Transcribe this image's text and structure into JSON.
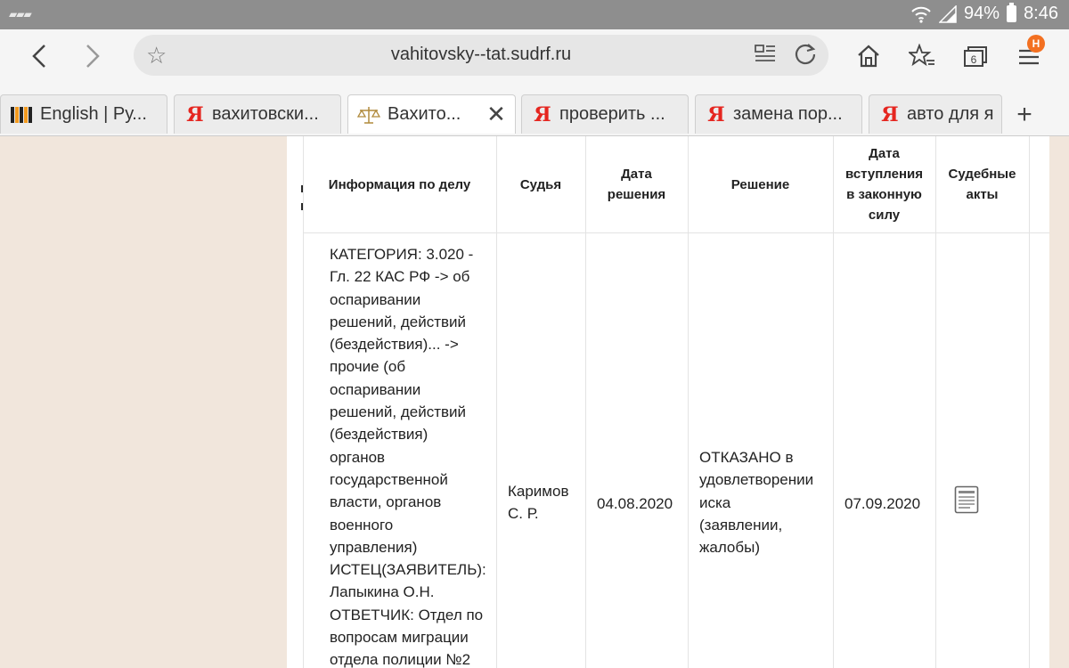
{
  "status": {
    "battery": "94%",
    "time": "8:46"
  },
  "toolbar": {
    "url": "vahitovsky--tat.sudrf.ru",
    "tab_count": "6",
    "badge": "Н"
  },
  "tabs": [
    {
      "label": "English | Ру..."
    },
    {
      "label": "вахитовски..."
    },
    {
      "label": "Вахито..."
    },
    {
      "label": "проверить ..."
    },
    {
      "label": "замена пор..."
    },
    {
      "label": "авто для я"
    }
  ],
  "table": {
    "headers": {
      "info": "Информация по делу",
      "judge": "Судья",
      "date": [
        "Дата",
        "решения"
      ],
      "decision": "Решение",
      "effective": [
        "Дата",
        "вступления",
        "в законную",
        "силу"
      ],
      "acts": [
        "Судебные",
        "акты"
      ]
    },
    "row": {
      "info_lines": [
        "КАТЕГОРИЯ: 3.020 -",
        "Гл. 22 КАС РФ -> об",
        "оспаривании",
        "решений, действий",
        "(бездействия)... ->",
        "прочие (об",
        "оспаривании",
        "решений, действий",
        "(бездействия)",
        "органов",
        "государственной",
        "власти, органов",
        "военного",
        "управления)",
        "ИСТЕЦ(ЗАЯВИТЕЛЬ):",
        "Лапыкина О.Н.",
        "ОТВЕТЧИК: Отдел по",
        "вопросам миграции",
        "отдела полиции №2"
      ],
      "judge_lines": [
        "Каримов",
        "С. Р."
      ],
      "date": "04.08.2020",
      "decision_lines": [
        "ОТКАЗАНО в",
        "удовлетворении",
        "иска",
        "(заявлении,",
        "жалобы)"
      ],
      "effective_date": "07.09.2020"
    }
  }
}
